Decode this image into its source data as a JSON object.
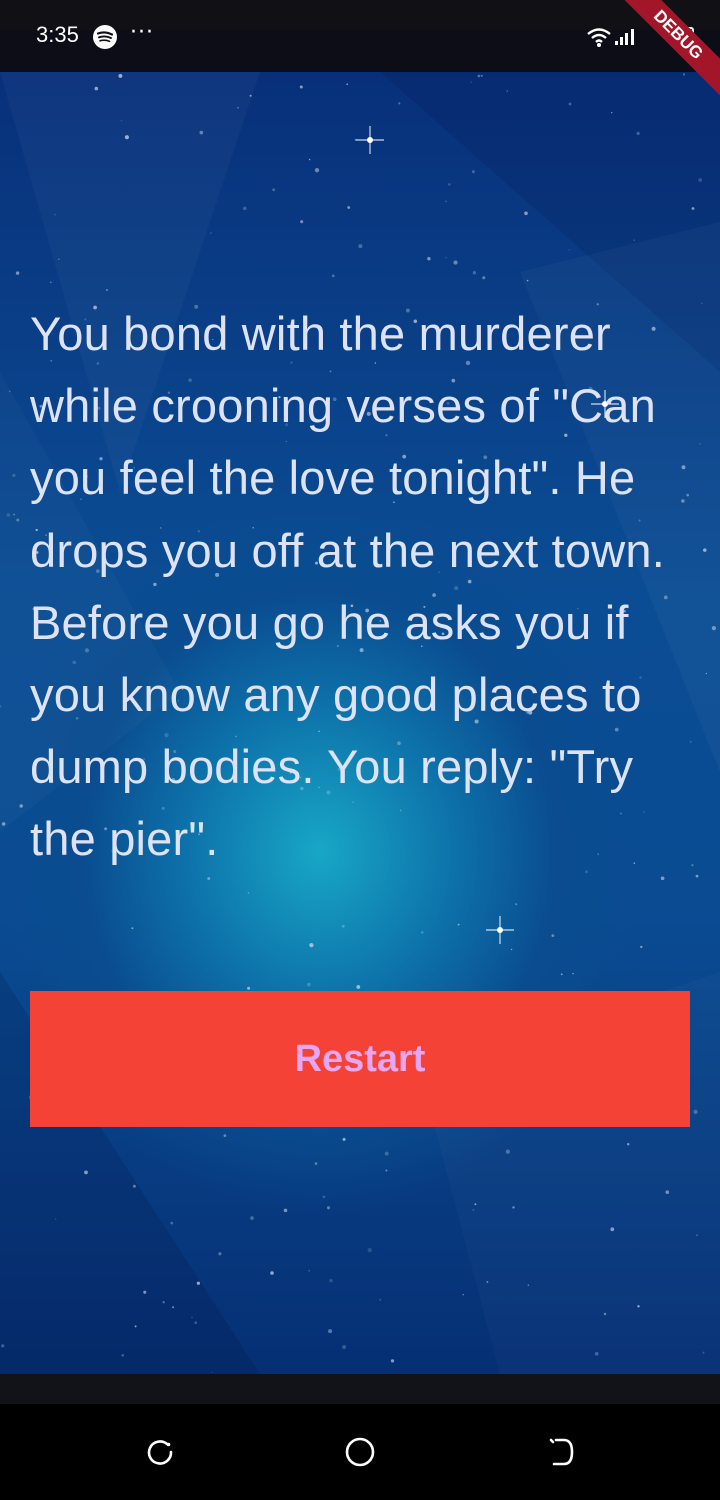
{
  "status_bar": {
    "time": "3:35",
    "more": "···",
    "debug_label": "DEBUG",
    "icons": [
      "spotify-icon",
      "more-icon",
      "wifi-icon",
      "signal-icon",
      "battery-icon"
    ]
  },
  "story": {
    "text": "You bond with the murderer while crooning verses of \"Can you feel the love tonight\". He drops you off at the next town. Before you go he asks you if you know any good places to dump bodies. You reply: \"Try the pier\"."
  },
  "restart_button": {
    "label": "Restart"
  },
  "nav_bar": {
    "icons": [
      "recents-icon",
      "home-icon",
      "back-icon"
    ]
  },
  "colors": {
    "button_bg": "#f44336",
    "button_text": "#e7a6f2",
    "story_text": "#dde3f4",
    "background_dark": "#08307a",
    "background_glow": "#18a7c6"
  }
}
